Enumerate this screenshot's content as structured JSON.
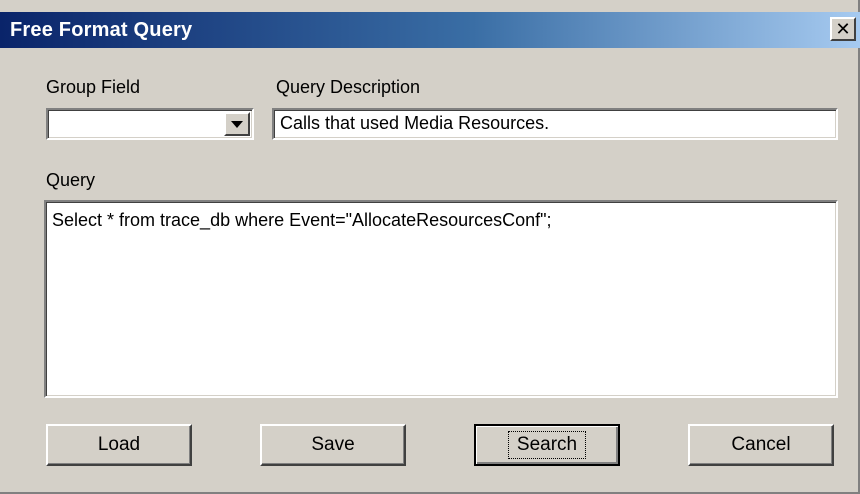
{
  "window": {
    "title": "Free Format Query",
    "close_glyph": "✕"
  },
  "group_field": {
    "label": "Group Field",
    "value": ""
  },
  "query_description": {
    "label": "Query Description",
    "value": "Calls that used Media Resources."
  },
  "query": {
    "label": "Query",
    "value": "Select * from trace_db where Event=\"AllocateResourcesConf\";"
  },
  "buttons": {
    "load": "Load",
    "save": "Save",
    "search": "Search",
    "cancel": "Cancel"
  },
  "icons": {
    "close": "close-icon",
    "dropdown": "chevron-down-icon"
  }
}
